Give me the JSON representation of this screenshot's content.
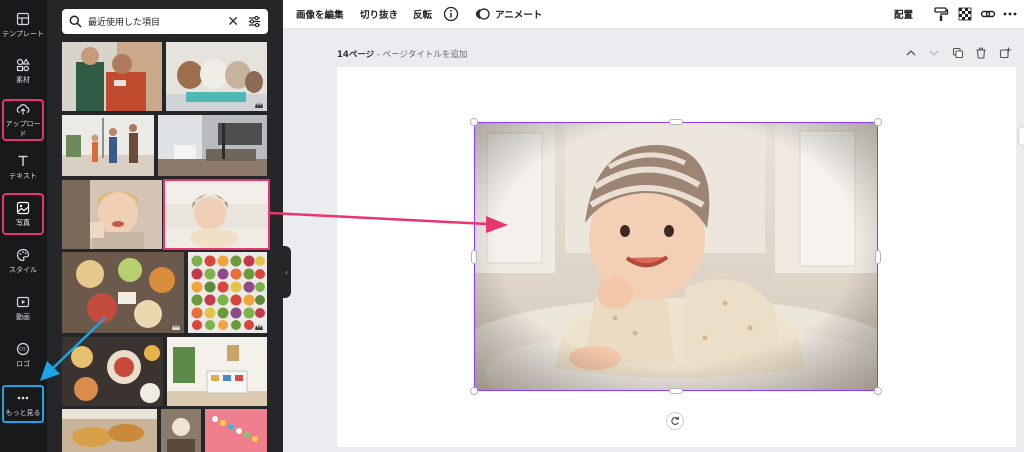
{
  "sidebar": {
    "items": [
      {
        "label": "テンプレート",
        "icon": "template-icon"
      },
      {
        "label": "素材",
        "icon": "elements-icon"
      },
      {
        "label": "アップロード",
        "icon": "upload-cloud-icon"
      },
      {
        "label": "テキスト",
        "icon": "text-icon"
      },
      {
        "label": "写真",
        "icon": "photo-icon"
      },
      {
        "label": "スタイル",
        "icon": "palette-icon"
      },
      {
        "label": "動画",
        "icon": "video-icon"
      },
      {
        "label": "ロゴ",
        "icon": "logo-icon"
      },
      {
        "label": "もっと見る",
        "icon": "more-icon"
      }
    ]
  },
  "search": {
    "value": "最近使用した項目"
  },
  "toolbar": {
    "edit_image": "画像を編集",
    "crop": "切り抜き",
    "flip": "反転",
    "animate": "アニメート",
    "position": "配置"
  },
  "page": {
    "number_label": "14ページ",
    "title_placeholder": "ページタイトルを追加",
    "separator": " - "
  },
  "colors": {
    "highlight_pink": "#e8356f",
    "highlight_blue": "#1ba4e8",
    "selection_purple": "#8b3dff"
  }
}
